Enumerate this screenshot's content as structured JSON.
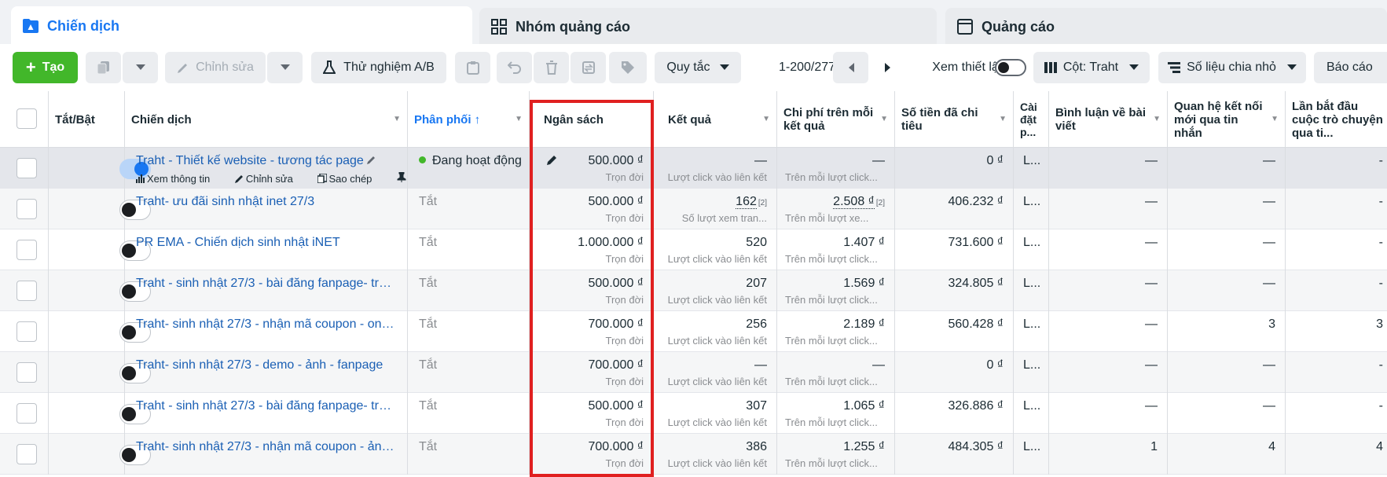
{
  "tabs": {
    "campaigns": "Chiến dịch",
    "ad_sets": "Nhóm quảng cáo",
    "ads": "Quảng cáo"
  },
  "toolbar": {
    "create": "Tạo",
    "edit": "Chỉnh sửa",
    "ab_test": "Thử nghiệm A/B",
    "rules": "Quy tắc",
    "pagination": "1-200/277",
    "view_setup": "Xem thiết lập",
    "columns": "Cột: Traht",
    "breakdown": "Số liệu chia nhỏ",
    "reports": "Báo cáo"
  },
  "headers": {
    "toggle": "Tắt/Bật",
    "campaign": "Chiến dịch",
    "delivery": "Phân phối ↑",
    "budget": "Ngân sách",
    "results": "Kết quả",
    "cost_per_result": "Chi phí trên mỗi kết quả",
    "amount_spent": "Số tiền đã chi tiêu",
    "attribution": "Cài đặt p...",
    "comments": "Bình luận về bài viết",
    "messaging_connections": "Quan hệ kết nối mới qua tin nhắn",
    "conversations_started": "Lần bắt đầu cuộc trò chuyện qua ti..."
  },
  "row_actions": {
    "view": "Xem thông tin",
    "edit": "Chỉnh sửa",
    "duplicate": "Sao chép"
  },
  "rows": [
    {
      "name": "Traht - Thiết kế website - tương tác page",
      "delivery": "Đang hoạt động",
      "budget": "500.000 ₫",
      "budget_type": "Trọn đời",
      "results": "—",
      "results_sub": "Lượt click vào liên kết",
      "cpr": "—",
      "cpr_sub": "Trên mỗi lượt click...",
      "spent": "0 ₫",
      "attr": "L...",
      "comments": "—",
      "msg": "—",
      "conv": "-"
    },
    {
      "name": "Traht- ưu đãi sinh nhật inet 27/3",
      "delivery": "Tắt",
      "budget": "500.000 ₫",
      "budget_type": "Trọn đời",
      "results": "162",
      "results_fn": "[2]",
      "results_sub": "Số lượt xem tran...",
      "cpr": "2.508 ₫",
      "cpr_fn": "[2]",
      "cpr_sub": "Trên mỗi lượt xe...",
      "spent": "406.232 ₫",
      "attr": "L...",
      "comments": "—",
      "msg": "—",
      "conv": "-"
    },
    {
      "name": "PR EMA - Chiến dịch sinh nhật iNET",
      "delivery": "Tắt",
      "budget": "1.000.000 ₫",
      "budget_type": "Trọn đời",
      "results": "520",
      "results_sub": "Lượt click vào liên kết",
      "cpr": "1.407 ₫",
      "cpr_sub": "Trên mỗi lượt click...",
      "spent": "731.600 ₫",
      "attr": "L...",
      "comments": "—",
      "msg": "—",
      "conv": "-"
    },
    {
      "name": "Traht - sinh nhật 27/3 - bài đăng fanpage- tru...",
      "delivery": "Tắt",
      "budget": "500.000 ₫",
      "budget_type": "Trọn đời",
      "results": "207",
      "results_sub": "Lượt click vào liên kết",
      "cpr": "1.569 ₫",
      "cpr_sub": "Trên mỗi lượt click...",
      "spent": "324.805 ₫",
      "attr": "L...",
      "comments": "—",
      "msg": "—",
      "conv": "-"
    },
    {
      "name": "Traht- sinh nhật 27/3 - nhận mã coupon - only...",
      "delivery": "Tắt",
      "budget": "700.000 ₫",
      "budget_type": "Trọn đời",
      "results": "256",
      "results_sub": "Lượt click vào liên kết",
      "cpr": "2.189 ₫",
      "cpr_sub": "Trên mỗi lượt click...",
      "spent": "560.428 ₫",
      "attr": "L...",
      "comments": "—",
      "msg": "3",
      "conv": "3"
    },
    {
      "name": "Traht- sinh nhật 27/3 - demo - ảnh - fanpage",
      "delivery": "Tắt",
      "budget": "700.000 ₫",
      "budget_type": "Trọn đời",
      "results": "—",
      "results_sub": "Lượt click vào liên kết",
      "cpr": "—",
      "cpr_sub": "Trên mỗi lượt click...",
      "spent": "0 ₫",
      "attr": "L...",
      "comments": "—",
      "msg": "—",
      "conv": "-"
    },
    {
      "name": "Traht - sinh nhật 27/3 - bài đăng fanpage- tru...",
      "delivery": "Tắt",
      "budget": "500.000 ₫",
      "budget_type": "Trọn đời",
      "results": "307",
      "results_sub": "Lượt click vào liên kết",
      "cpr": "1.065 ₫",
      "cpr_sub": "Trên mỗi lượt click...",
      "spent": "326.886 ₫",
      "attr": "L...",
      "comments": "—",
      "msg": "—",
      "conv": "-"
    },
    {
      "name": "Traht- sinh nhật 27/3 - nhận mã coupon - ảnh ...",
      "delivery": "Tắt",
      "budget": "700.000 ₫",
      "budget_type": "Trọn đời",
      "results": "386",
      "results_sub": "Lượt click vào liên kết",
      "cpr": "1.255 ₫",
      "cpr_sub": "Trên mỗi lượt click...",
      "spent": "484.305 ₫",
      "attr": "L...",
      "comments": "1",
      "msg": "4",
      "conv": "4"
    }
  ]
}
